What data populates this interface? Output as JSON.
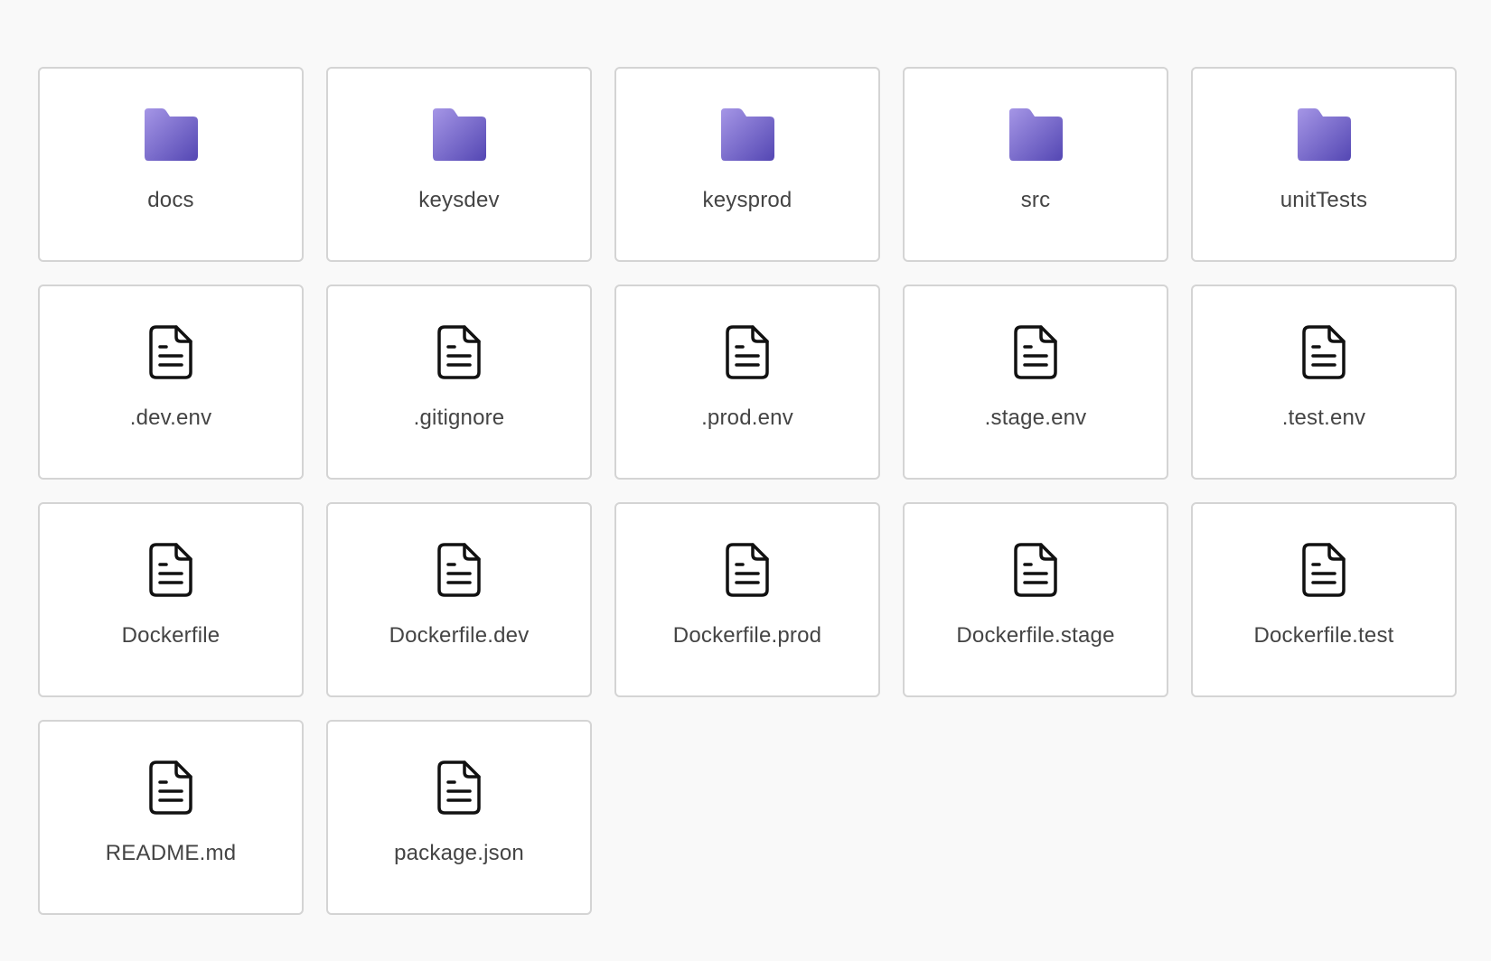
{
  "colors": {
    "background": "#f9f9f9",
    "tile_background": "#ffffff",
    "tile_border": "#d4d4d4",
    "folder_light": "#9c8ee0",
    "folder_dark": "#5b4fb9",
    "label_text": "#444444"
  },
  "items": [
    {
      "name": "docs",
      "type": "folder",
      "icon": "folder-icon"
    },
    {
      "name": "keysdev",
      "type": "folder",
      "icon": "folder-icon"
    },
    {
      "name": "keysprod",
      "type": "folder",
      "icon": "folder-icon"
    },
    {
      "name": "src",
      "type": "folder",
      "icon": "folder-icon"
    },
    {
      "name": "unitTests",
      "type": "folder",
      "icon": "folder-icon"
    },
    {
      "name": ".dev.env",
      "type": "file",
      "icon": "file-icon"
    },
    {
      "name": ".gitignore",
      "type": "file",
      "icon": "file-icon"
    },
    {
      "name": ".prod.env",
      "type": "file",
      "icon": "file-icon"
    },
    {
      "name": ".stage.env",
      "type": "file",
      "icon": "file-icon"
    },
    {
      "name": ".test.env",
      "type": "file",
      "icon": "file-icon"
    },
    {
      "name": "Dockerfile",
      "type": "file",
      "icon": "file-icon"
    },
    {
      "name": "Dockerfile.dev",
      "type": "file",
      "icon": "file-icon"
    },
    {
      "name": "Dockerfile.prod",
      "type": "file",
      "icon": "file-icon"
    },
    {
      "name": "Dockerfile.stage",
      "type": "file",
      "icon": "file-icon"
    },
    {
      "name": "Dockerfile.test",
      "type": "file",
      "icon": "file-icon"
    },
    {
      "name": "README.md",
      "type": "file",
      "icon": "file-icon"
    },
    {
      "name": "package.json",
      "type": "file",
      "icon": "file-icon"
    }
  ]
}
